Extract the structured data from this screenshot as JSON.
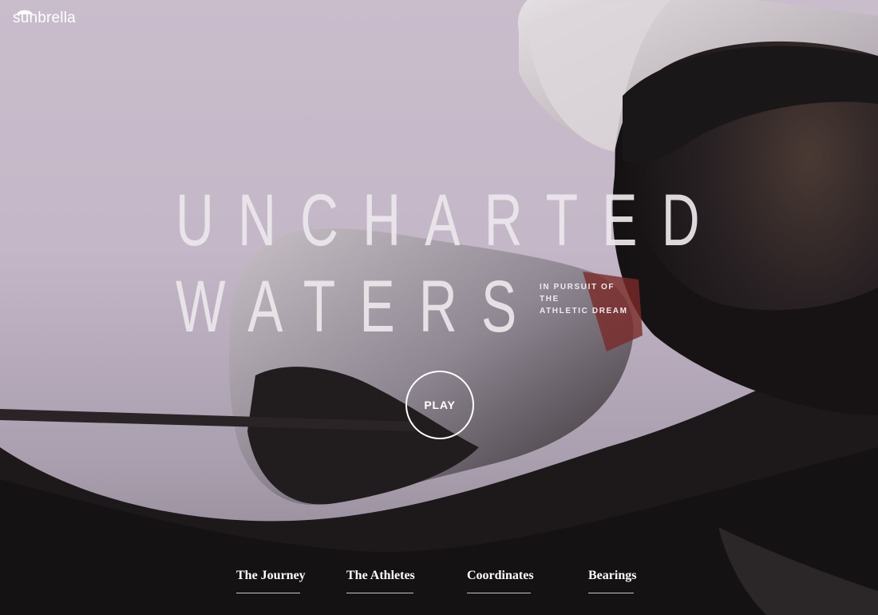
{
  "brand": {
    "name": "sunbrella",
    "icon": "umbrella-icon"
  },
  "hero": {
    "title_line1": "UNCHARTED",
    "title_line2": "WATERS",
    "tagline_line1": "IN PURSUIT OF THE",
    "tagline_line2": "ATHLETIC DREAM",
    "play_label": "PLAY"
  },
  "nav": {
    "items": [
      {
        "label": "The Journey"
      },
      {
        "label": "The Athletes"
      },
      {
        "label": "Coordinates"
      },
      {
        "label": "Bearings"
      }
    ]
  },
  "colors": {
    "sky": "#c7bbca",
    "text": "#ffffff",
    "shadow": "#141112"
  }
}
